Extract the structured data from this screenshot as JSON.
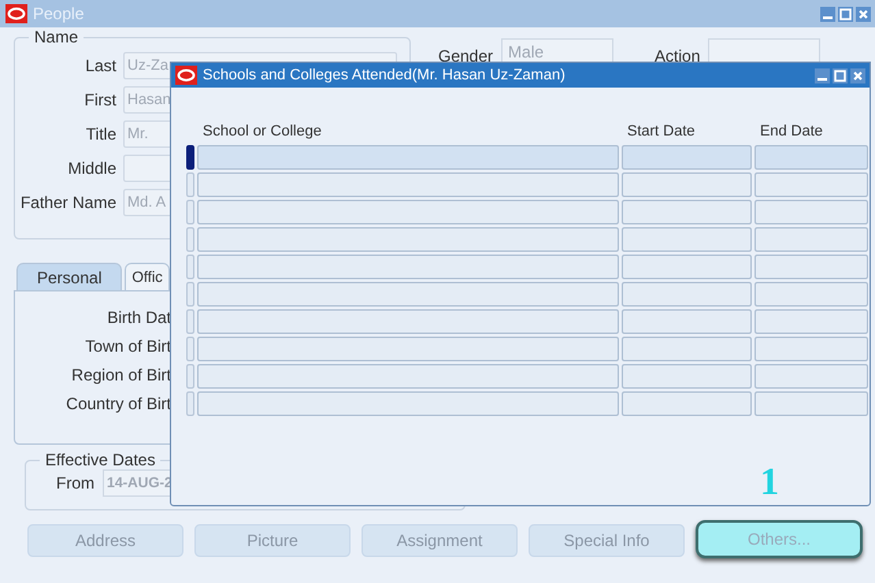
{
  "window": {
    "title": "People"
  },
  "name_group": {
    "legend": "Name",
    "fields": [
      {
        "label": "Last",
        "value": "Uz-Za"
      },
      {
        "label": "First",
        "value": "Hasan"
      },
      {
        "label": "Title",
        "value": "Mr."
      },
      {
        "label": "Middle"
      },
      {
        "label": "Father Name",
        "value": "Md. A"
      }
    ]
  },
  "gender": {
    "label": "Gender",
    "value": "Male"
  },
  "action": {
    "label": "Action"
  },
  "tabs": [
    {
      "label": "Personal",
      "selected": true
    },
    {
      "label": "Offic",
      "selected": false
    }
  ],
  "personal_labels": [
    "Birth Dat",
    "Town of Birt",
    "Region of Birt",
    "Country of Birt"
  ],
  "effective_dates": {
    "legend": "Effective Dates",
    "from_label": "From",
    "from_value": "14-AUG-2"
  },
  "buttons": [
    {
      "label": "Address",
      "highlighted": false
    },
    {
      "label": "Picture",
      "highlighted": false
    },
    {
      "label": "Assignment",
      "highlighted": false
    },
    {
      "label": "Special Info",
      "highlighted": false
    },
    {
      "label": "Others...",
      "highlighted": true
    }
  ],
  "dialog": {
    "title": "Schools and Colleges Attended(Mr. Hasan Uz-Zaman)",
    "columns": [
      "School or College",
      "Start Date",
      "End Date"
    ],
    "rows": [
      {
        "current": true
      },
      {
        "current": false
      },
      {
        "current": false
      },
      {
        "current": false
      },
      {
        "current": false
      },
      {
        "current": false
      },
      {
        "current": false
      },
      {
        "current": false
      },
      {
        "current": false
      },
      {
        "current": false
      }
    ]
  },
  "step_marker": "1"
}
